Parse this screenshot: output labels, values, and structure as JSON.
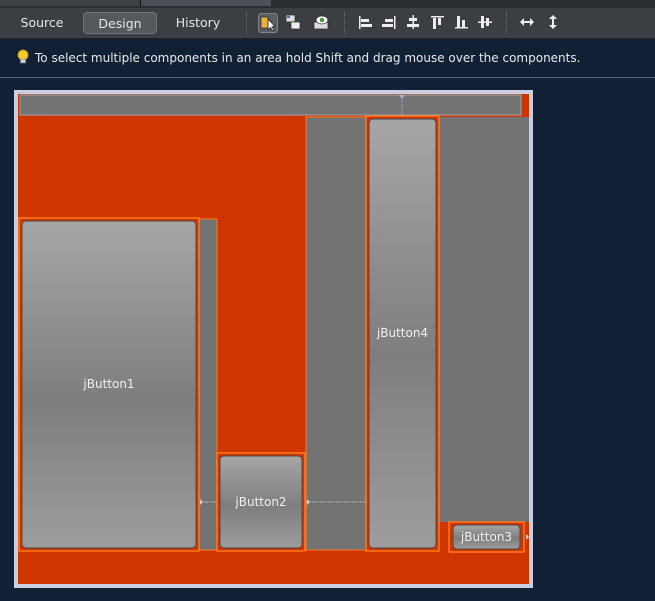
{
  "toolbar": {
    "tabs": [
      {
        "label": "Source"
      },
      {
        "label": "Design"
      },
      {
        "label": "History"
      }
    ],
    "active_tab": "Design",
    "tools": [
      {
        "icon": "selection-mode-icon"
      },
      {
        "icon": "connection-mode-icon"
      },
      {
        "icon": "preview-design-icon"
      },
      {
        "icon": "align-left-icon"
      },
      {
        "icon": "align-right-icon"
      },
      {
        "icon": "center-horizontally-icon"
      },
      {
        "icon": "align-top-icon"
      },
      {
        "icon": "align-bottom-icon"
      },
      {
        "icon": "center-vertically-icon"
      },
      {
        "icon": "resize-horizontal-icon"
      },
      {
        "icon": "resize-vertical-icon"
      }
    ]
  },
  "hint": {
    "text": "To select multiple components in an area hold Shift and drag mouse over the components."
  },
  "design": {
    "colors": {
      "panel_background": "#cf3500",
      "selection_outline": "#ff7a1a",
      "form_border": "#c9cfe0"
    },
    "buttons": [
      {
        "label": "jButton1"
      },
      {
        "label": "jButton2"
      },
      {
        "label": "jButton3"
      },
      {
        "label": "jButton4"
      }
    ]
  }
}
